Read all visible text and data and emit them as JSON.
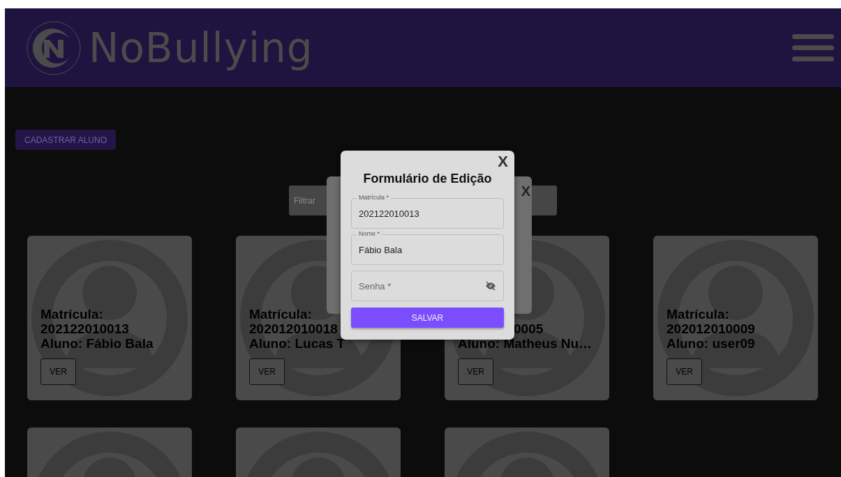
{
  "header": {
    "logo_text": "NoBullying"
  },
  "actions": {
    "register_button": "CADASTRAR ALUNO"
  },
  "filter": {
    "placeholder": "Filtrar"
  },
  "cards": [
    {
      "kind": "student",
      "covered": false,
      "label": "Matrícula:",
      "number": "202122010013",
      "name": "Aluno: Fábio Bala",
      "button": "VER"
    },
    {
      "kind": "student",
      "covered": false,
      "label": "Matrícula:",
      "number": "202012010018",
      "name": "Aluno: Lucas T",
      "button": "VER"
    },
    {
      "kind": "student",
      "covered": true,
      "number": "0005",
      "name": "Aluno: Matheus Nu…",
      "button": "VER"
    },
    {
      "kind": "student",
      "covered": false,
      "label": "Matrícula:",
      "number": "202012010009",
      "name": "Aluno: user09",
      "button": "VER"
    },
    {
      "kind": "avatar"
    },
    {
      "kind": "avatar"
    },
    {
      "kind": "avatar"
    }
  ],
  "back_dialog": {
    "close": "X"
  },
  "dialog": {
    "close": "X",
    "title": "Formulário de Edição",
    "fields": [
      {
        "kind": "text",
        "label": "Matrícula *",
        "value": "202122010013"
      },
      {
        "kind": "text",
        "label": "Nome *",
        "value": "Fábio Bala"
      },
      {
        "kind": "password",
        "placeholder": "Senha *"
      }
    ],
    "submit": "SALVAR"
  }
}
